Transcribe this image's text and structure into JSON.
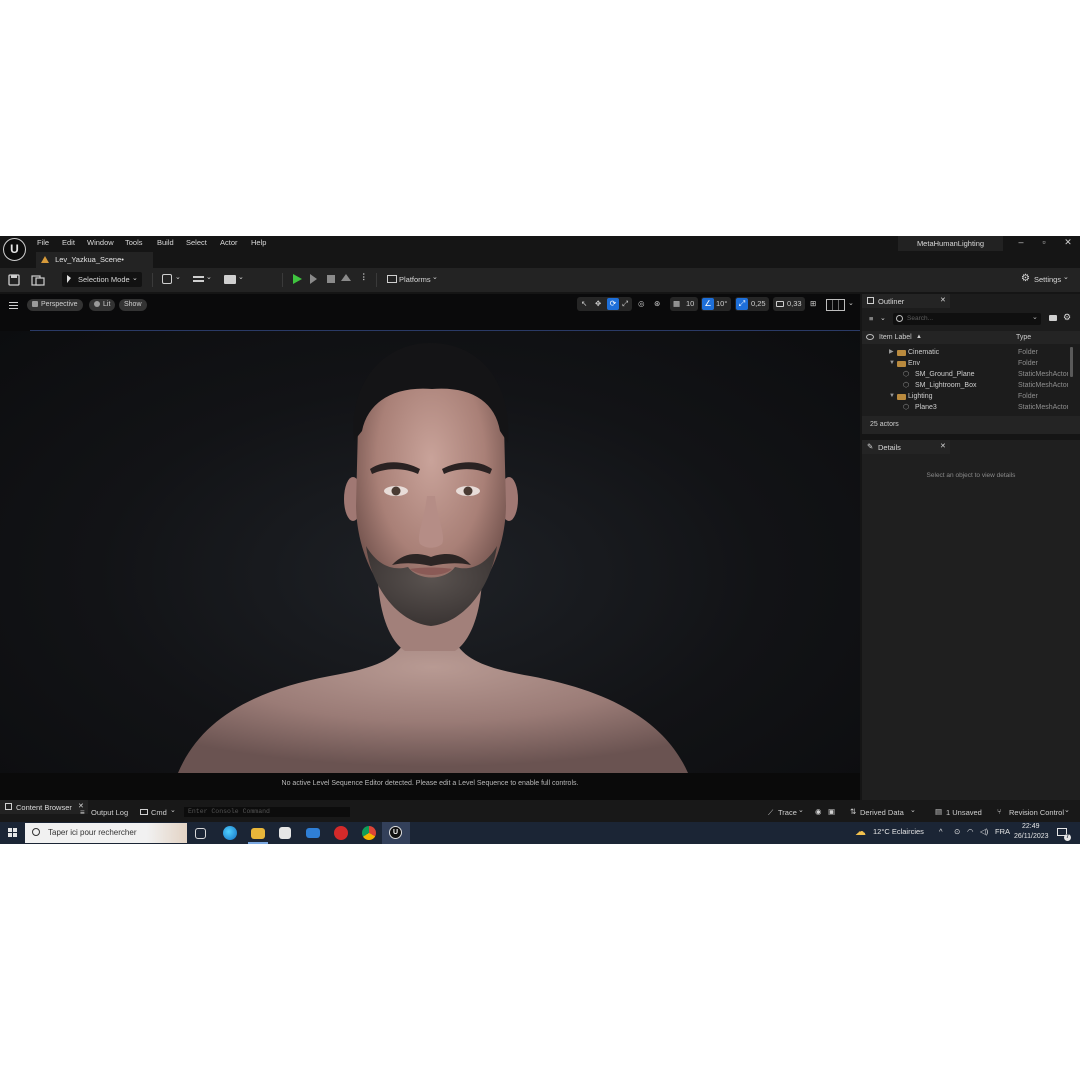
{
  "titlebar": {
    "logo_text": "U",
    "menus": [
      "File",
      "Edit",
      "Window",
      "Tools",
      "Build",
      "Select",
      "Actor",
      "Help"
    ],
    "project": "MetaHumanLighting",
    "minimize": "–",
    "restore": "▫",
    "close": "✕",
    "level_tab": "Lev_Yazkua_Scene•"
  },
  "toolbar": {
    "selection_mode": "Selection Mode",
    "platforms": "Platforms",
    "settings": "Settings"
  },
  "viewport": {
    "menu_icon": "hamburger-icon",
    "perspective": "Perspective",
    "lit": "Lit",
    "show": "Show",
    "grid_snap": "10",
    "rot_snap": "10°",
    "scale_snap": "0,25",
    "camera_speed": "0,33",
    "sequencer_message": "No active Level Sequence Editor detected. Please edit a Level Sequence to enable full controls."
  },
  "outliner": {
    "title": "Outliner",
    "search_placeholder": "Search...",
    "col_label": "Item Label",
    "col_type": "Type",
    "rows": [
      {
        "label": "Cinematic",
        "type": "Folder"
      },
      {
        "label": "Env",
        "type": "Folder"
      },
      {
        "label": "SM_Ground_Plane",
        "type": "StaticMeshActor"
      },
      {
        "label": "SM_Lightroom_Box",
        "type": "StaticMeshActor"
      },
      {
        "label": "Lighting",
        "type": "Folder"
      },
      {
        "label": "Plane3",
        "type": "StaticMeshActor"
      }
    ],
    "count": "25 actors"
  },
  "details": {
    "title": "Details",
    "empty_text": "Select an object to view details"
  },
  "bottombar": {
    "content_browser": "Content Browser",
    "output_log": "Output Log",
    "cmd": "Cmd",
    "console_placeholder": "Enter Console Command",
    "trace": "Trace",
    "derived_data": "Derived Data",
    "unsaved": "1 Unsaved",
    "revision_control": "Revision Control"
  },
  "taskbar": {
    "search_text": "Taper ici pour rechercher",
    "weather": "12°C  Eclaircies",
    "language": "FRA",
    "time": "22:49",
    "date": "26/11/2023"
  },
  "colors": {
    "play_green": "#3fc43f",
    "accent_blue": "#1e6fd9",
    "folder": "#b98a3e"
  }
}
